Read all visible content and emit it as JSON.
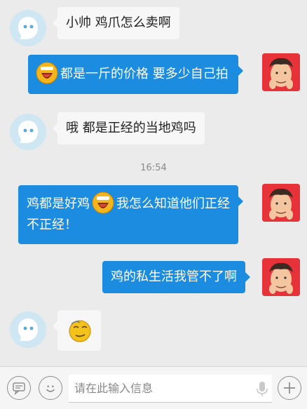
{
  "messages": [
    {
      "side": "left",
      "text": "小帅 鸡爪怎么卖啊"
    },
    {
      "side": "right",
      "emoji": "laughing-emoji",
      "text": "都是一斤的价格 要多少自己拍"
    },
    {
      "side": "left",
      "text": "哦 都是正经的当地鸡吗"
    },
    {
      "side": "right",
      "line1_a": "鸡都是好鸡",
      "emoji": "laughing-emoji",
      "line1_b": "我怎么知道他们正经",
      "line2": "不正经！"
    },
    {
      "side": "right",
      "text": "鸡的私生活我管不了啊"
    },
    {
      "side": "left",
      "emoji": "smug-emoji"
    }
  ],
  "timestamp": "16:54",
  "input": {
    "placeholder": "请在此输入信息"
  },
  "colors": {
    "bubble_right": "#1b8ce0",
    "bubble_left": "#f7f7f7",
    "background": "#ebebeb"
  },
  "icons": [
    "chat-bubble-icon",
    "smiley-icon",
    "microphone-icon",
    "plus-icon"
  ]
}
